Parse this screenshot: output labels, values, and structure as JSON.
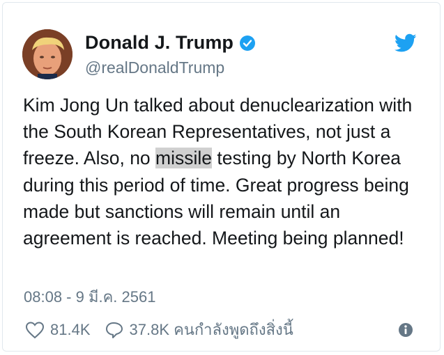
{
  "author": {
    "display_name": "Donald J. Trump",
    "handle": "@realDonaldTrump",
    "verified": true
  },
  "tweet": {
    "text_before": "Kim Jong Un talked about denuclearization with the South Korean Representatives, not just a freeze. Also, no ",
    "highlight": "missile",
    "text_after": " testing by North Korea during this period of time. Great progress being made but sanctions will remain until an agreement is reached. Meeting being planned!",
    "timestamp": "08:08 - 9 มี.ค. 2561"
  },
  "actions": {
    "likes": "81.4K",
    "replies": "37.8K คนกำลังพูดถึงสิ่งนี้"
  },
  "colors": {
    "accent": "#1da1f2",
    "secondary_text": "#657786",
    "highlight": "#d0d0d0"
  },
  "icons": [
    "twitter-bird-icon",
    "verified-badge-icon",
    "heart-icon",
    "reply-bubble-icon",
    "info-icon"
  ]
}
